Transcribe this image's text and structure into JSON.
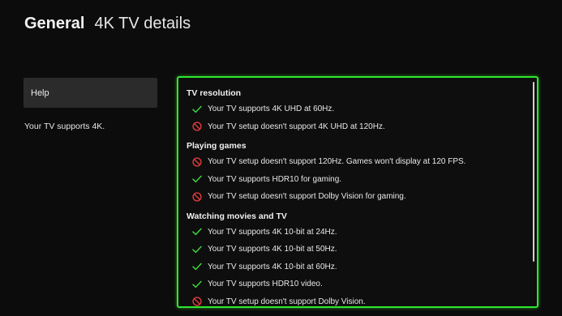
{
  "header": {
    "section": "General",
    "page": "4K TV details"
  },
  "sidebar": {
    "help_label": "Help",
    "status_text": "Your TV supports 4K."
  },
  "colors": {
    "accent_green": "#2ee82e",
    "check_green": "#3fd23f",
    "block_red": "#e23a3a"
  },
  "groups": [
    {
      "title": "TV resolution",
      "items": [
        {
          "status": "supported",
          "icon": "check-icon",
          "text": "Your TV supports 4K UHD at 60Hz."
        },
        {
          "status": "unsupported",
          "icon": "block-icon",
          "text": "Your TV setup doesn't support 4K UHD at 120Hz."
        }
      ]
    },
    {
      "title": "Playing games",
      "items": [
        {
          "status": "unsupported",
          "icon": "block-icon",
          "text": "Your TV setup doesn't support 120Hz. Games won't display at 120 FPS."
        },
        {
          "status": "supported",
          "icon": "check-icon",
          "text": "Your TV supports HDR10 for gaming."
        },
        {
          "status": "unsupported",
          "icon": "block-icon",
          "text": "Your TV setup doesn't support Dolby Vision for gaming."
        }
      ]
    },
    {
      "title": "Watching movies and TV",
      "items": [
        {
          "status": "supported",
          "icon": "check-icon",
          "text": "Your TV supports 4K 10-bit at 24Hz."
        },
        {
          "status": "supported",
          "icon": "check-icon",
          "text": "Your TV supports 4K 10-bit at 50Hz."
        },
        {
          "status": "supported",
          "icon": "check-icon",
          "text": "Your TV supports 4K 10-bit at 60Hz."
        },
        {
          "status": "supported",
          "icon": "check-icon",
          "text": "Your TV supports HDR10 video."
        },
        {
          "status": "unsupported",
          "icon": "block-icon",
          "text": "Your TV setup doesn't support Dolby Vision."
        }
      ]
    }
  ]
}
